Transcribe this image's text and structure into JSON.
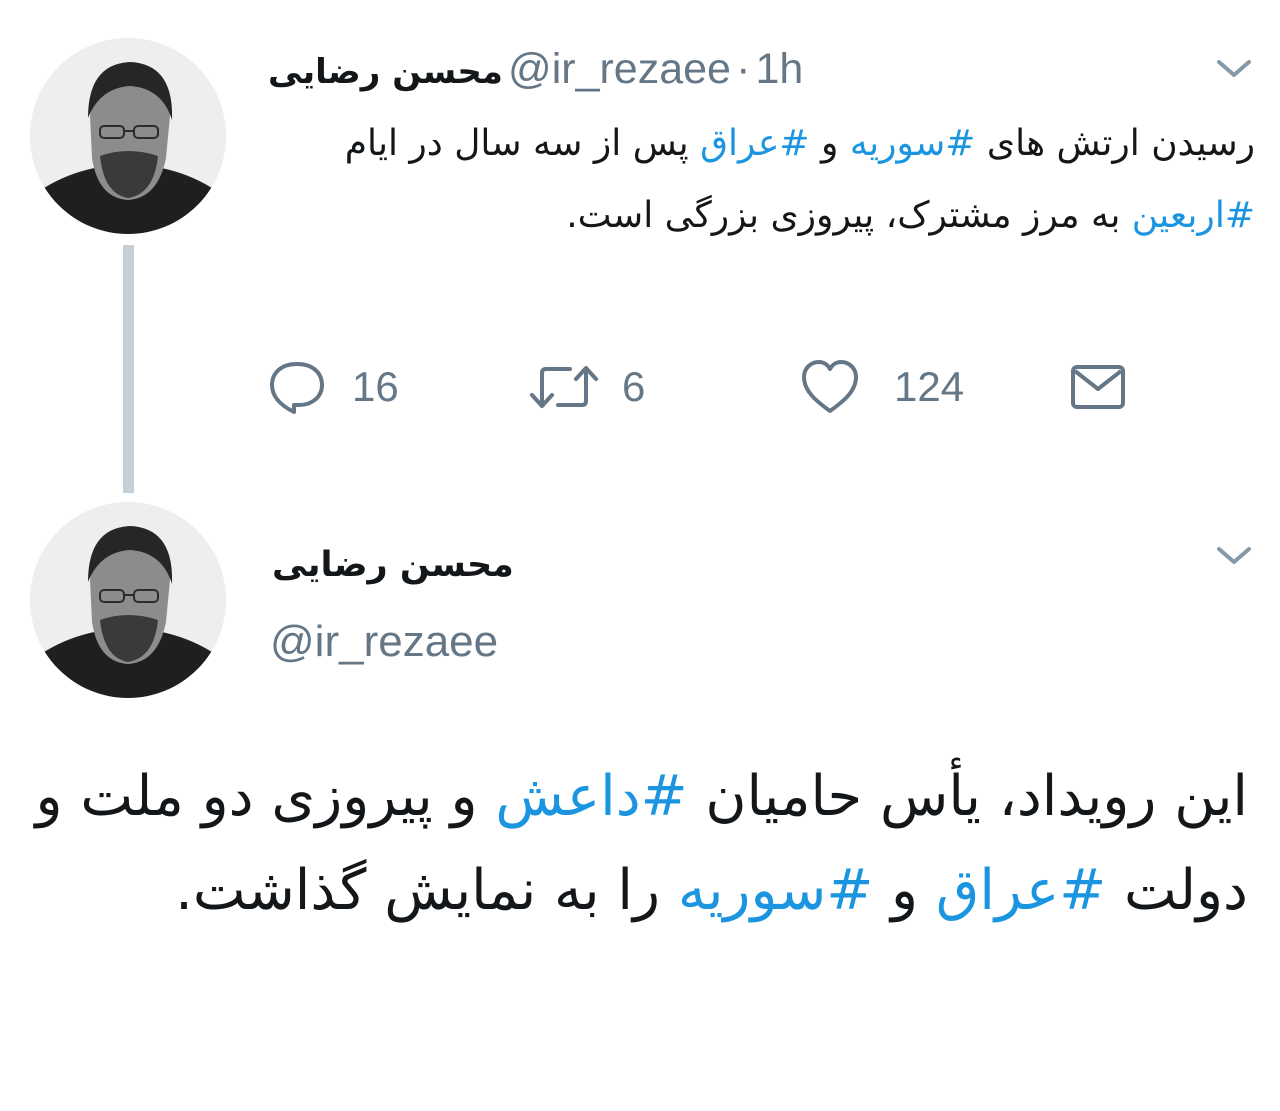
{
  "tweet1": {
    "author_name": "محسن رضایی",
    "handle": "@ir_rezaee",
    "separator": "·",
    "time": "1h",
    "text_parts": [
      {
        "text": "رسیدن ارتش های  ",
        "tag": false
      },
      {
        "text": "#سوریه",
        "tag": true
      },
      {
        "text": " و ",
        "tag": false
      },
      {
        "text": "#عراق",
        "tag": true
      },
      {
        "text": " پس از سه سال در ایام ",
        "tag": false
      },
      {
        "text": "#اربعین",
        "tag": true
      },
      {
        "text": " به مرز مشترک، پیروزی بزرگی است.",
        "tag": false
      }
    ],
    "reply_count": "16",
    "retweet_count": "6",
    "like_count": "124"
  },
  "tweet2": {
    "author_name": "محسن رضایی",
    "handle": "@ir_rezaee",
    "text_parts": [
      {
        "text": "این رویداد، یأس حامیان ",
        "tag": false
      },
      {
        "text": "#داعش",
        "tag": true
      },
      {
        "text": " و پیروزی دو ملت و دولت ",
        "tag": false
      },
      {
        "text": "#عراق",
        "tag": true
      },
      {
        "text": " و ",
        "tag": false
      },
      {
        "text": "#سوریه",
        "tag": true
      },
      {
        "text": " را به نمایش گذاشت.",
        "tag": false
      }
    ]
  },
  "icons": {
    "reply": "reply-icon",
    "retweet": "retweet-icon",
    "like": "heart-icon",
    "dm": "envelope-icon",
    "more": "chevron-down-icon"
  },
  "colors": {
    "hashtag": "#1b95e0",
    "secondary_text": "#657786",
    "thread_line": "#c4cfd6"
  }
}
